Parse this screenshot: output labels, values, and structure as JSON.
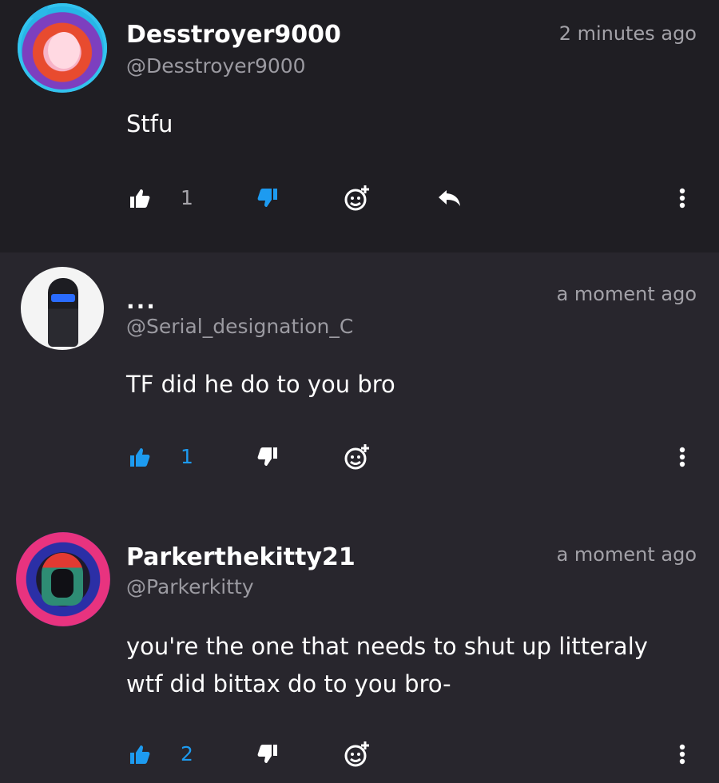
{
  "colors": {
    "accent": "#1d9bf0",
    "text": "#ffffff",
    "muted": "#9b9aa1",
    "bg_top": "#1f1e23",
    "bg": "#28262d"
  },
  "comments": [
    {
      "display_name": "Desstroyer9000",
      "handle": "@Desstroyer9000",
      "time": "2 minutes ago",
      "text": "Stfu",
      "likes": "1",
      "liked": false,
      "disliked": true,
      "show_reply": true
    },
    {
      "display_name": "...",
      "handle": "@Serial_designation_C",
      "time": "a moment ago",
      "text": "TF did he do to you bro",
      "likes": "1",
      "liked": true,
      "disliked": false,
      "show_reply": false
    },
    {
      "display_name": "Parkerthekitty21",
      "handle": "@Parkerkitty",
      "time": "a moment ago",
      "text_lines": [
        "you're the one that needs to shut up litteraly",
        "wtf did bittax do to you bro-"
      ],
      "likes": "2",
      "liked": true,
      "disliked": false,
      "show_reply": false
    }
  ],
  "icons": {
    "like": "thumbs-up-icon",
    "dislike": "thumbs-down-icon",
    "reaction": "add-reaction-icon",
    "reply": "reply-icon",
    "more": "more-vertical-icon"
  }
}
